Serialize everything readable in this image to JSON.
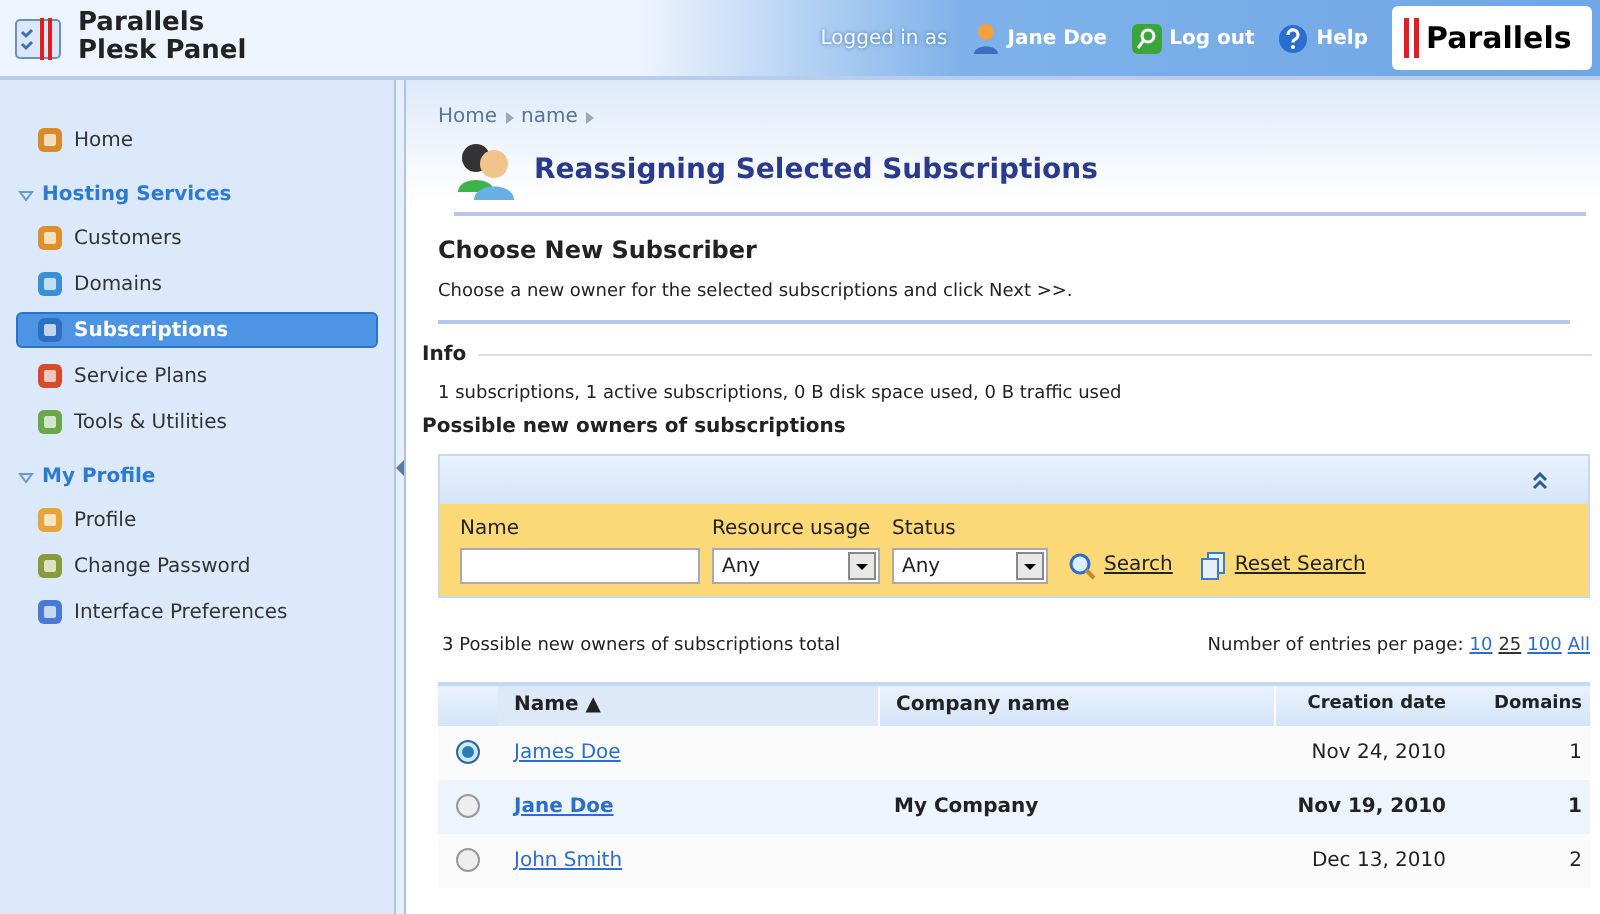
{
  "header": {
    "product": [
      "Parallels",
      "Plesk Panel"
    ],
    "logged_in_label": "Logged in as",
    "user": "Jane Doe",
    "logout": "Log out",
    "help": "Help",
    "brand": "Parallels"
  },
  "sidebar": {
    "items": [
      {
        "kind": "link",
        "label": "Home",
        "selected": false
      },
      {
        "kind": "section",
        "label": "Hosting Services",
        "expanded": true
      },
      {
        "kind": "link",
        "label": "Customers",
        "selected": false
      },
      {
        "kind": "link",
        "label": "Domains",
        "selected": false
      },
      {
        "kind": "link",
        "label": "Subscriptions",
        "selected": true
      },
      {
        "kind": "link",
        "label": "Service Plans",
        "selected": false
      },
      {
        "kind": "link",
        "label": "Tools & Utilities",
        "selected": false
      },
      {
        "kind": "section",
        "label": "My Profile",
        "expanded": true
      },
      {
        "kind": "link",
        "label": "Profile",
        "selected": false
      },
      {
        "kind": "link",
        "label": "Change Password",
        "selected": false
      },
      {
        "kind": "link",
        "label": "Interface Preferences",
        "selected": false
      }
    ]
  },
  "breadcrumb": [
    "Home",
    "name"
  ],
  "title": "Reassigning Selected Subscriptions",
  "step": {
    "heading": "Choose New Subscriber",
    "description": "Choose a new owner for the selected subscriptions and click Next >>."
  },
  "info": {
    "heading": "Info",
    "text": "1 subscriptions, 1 active subscriptions, 0 B disk space used, 0 B traffic used"
  },
  "owners": {
    "heading": "Possible new owners of subscriptions",
    "filter": {
      "fields": [
        {
          "kind": "text",
          "label": "Name"
        },
        {
          "kind": "select",
          "label": "Resource usage",
          "value": "Any"
        },
        {
          "kind": "select",
          "label": "Status",
          "value": "Any"
        }
      ],
      "search": "Search",
      "reset": "Reset Search"
    },
    "total": "3 Possible new owners of subscriptions total",
    "per_page_label": "Number of entries per page:",
    "per_page": [
      {
        "label": "10",
        "selected": false
      },
      {
        "label": "25",
        "selected": true
      },
      {
        "label": "100",
        "selected": false
      },
      {
        "label": "All",
        "selected": false
      }
    ],
    "table": {
      "columns": [
        "Name ▲",
        "Company name",
        "Creation date",
        "Domains"
      ],
      "rows": [
        {
          "selected": true,
          "current": false,
          "name": "James Doe",
          "created": "Nov 24, 2010",
          "domains": "1"
        },
        {
          "selected": false,
          "current": true,
          "name": "Jane Doe",
          "company": "My Company",
          "created": "Nov 19, 2010",
          "domains": "1"
        },
        {
          "selected": false,
          "current": false,
          "name": "John Smith",
          "created": "Dec 13, 2010",
          "domains": "2"
        }
      ]
    }
  }
}
